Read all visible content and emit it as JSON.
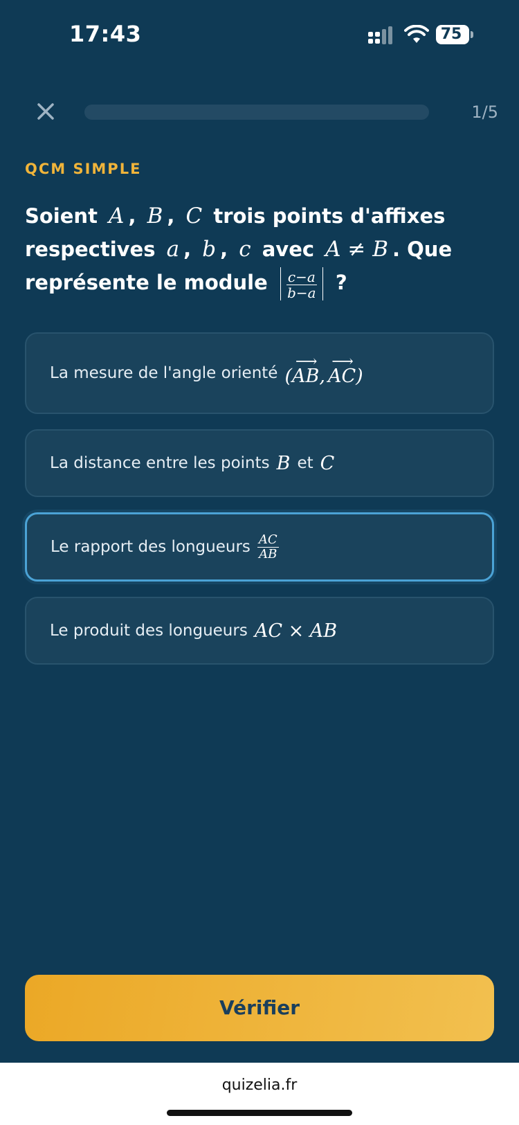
{
  "status_bar": {
    "time": "17:43",
    "battery": "75"
  },
  "header": {
    "progress_text": "1/5",
    "progress_fraction": 0.0
  },
  "question": {
    "type_label": "QCM SIMPLE",
    "text_parts": {
      "p1": "Soient",
      "m1": "A",
      "c1": ",",
      "m2": "B",
      "c2": ",",
      "m3": "C",
      "p2": "trois points d'affixes respectives",
      "m4": "a",
      "c3": ",",
      "m5": "b",
      "c4": ",",
      "m6": "c",
      "p3": "avec",
      "m7": "A ≠ B",
      "p4": ". Que représente le module",
      "frac_num": "c−a",
      "frac_den": "b−a",
      "p5": "?"
    }
  },
  "options": [
    {
      "text": "La mesure de l'angle orienté",
      "math_open": "(",
      "vec1": "AB",
      "comma": ",",
      "vec2": "AC",
      "math_close": ")",
      "arrow": "⟶"
    },
    {
      "text": "La distance entre les points",
      "m1": "B",
      "mid": "et",
      "m2": "C"
    },
    {
      "text": "Le rapport des longueurs",
      "frac_num": "AC",
      "frac_den": "AB",
      "selected": true
    },
    {
      "text": "Le produit des longueurs",
      "math": "AC × AB"
    }
  ],
  "actions": {
    "verify_label": "Vérifier"
  },
  "browser": {
    "url": "quizelia.fr"
  },
  "colors": {
    "background": "#0f3a55",
    "accent": "#f0b43a",
    "selected_border": "#4ba3d6",
    "option_bg": "#1a435c"
  }
}
